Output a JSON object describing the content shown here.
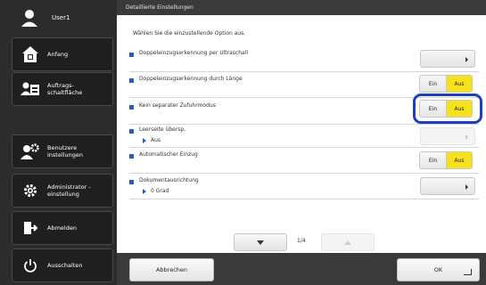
{
  "colors": {
    "sidebar_bg": "#2c2c2c",
    "accent_blue": "#2a58c6",
    "selected_yellow": "#f7e11c",
    "focus_ring": "#1d3fb8"
  },
  "sidebar": {
    "user_label": "User1",
    "items": [
      {
        "label": "Anfang",
        "icon": "home-icon"
      },
      {
        "label": "Auftrags-\nschaltfläche",
        "icon": "job-panel-icon"
      },
      {
        "label": "Benutzere instellungen",
        "icon": "user-settings-icon"
      },
      {
        "label": "Administrator -\neinstellung",
        "icon": "admin-gear-icon"
      },
      {
        "label": "Abmelden",
        "icon": "logout-icon"
      },
      {
        "label": "Ausschalten",
        "icon": "power-icon"
      }
    ]
  },
  "panel": {
    "header": "Detaillierte Einstellungen",
    "instruction": "Wählen Sie die einzustellende Option aus.",
    "options": [
      {
        "title": "Doppeleinzugserkennung per Ultraschall"
      },
      {
        "title": "Doppeleinzugserkennung durch Länge",
        "off_label": "Ein",
        "on_label": "Aus"
      },
      {
        "title": "Kein separater Zufuhrmodus",
        "off_label": "Ein",
        "on_label": "Aus"
      },
      {
        "title": "Leerseite übersp.",
        "value": "Aus"
      },
      {
        "title": "Automatischer Einzug",
        "off_label": "Ein",
        "on_label": "Aus"
      },
      {
        "title": "Dokumentausrichtung",
        "value": "0 Grad"
      }
    ],
    "pager": {
      "page": "1/4"
    }
  },
  "footer": {
    "cancel_label": "Abbrechen",
    "ok_label": "OK"
  }
}
